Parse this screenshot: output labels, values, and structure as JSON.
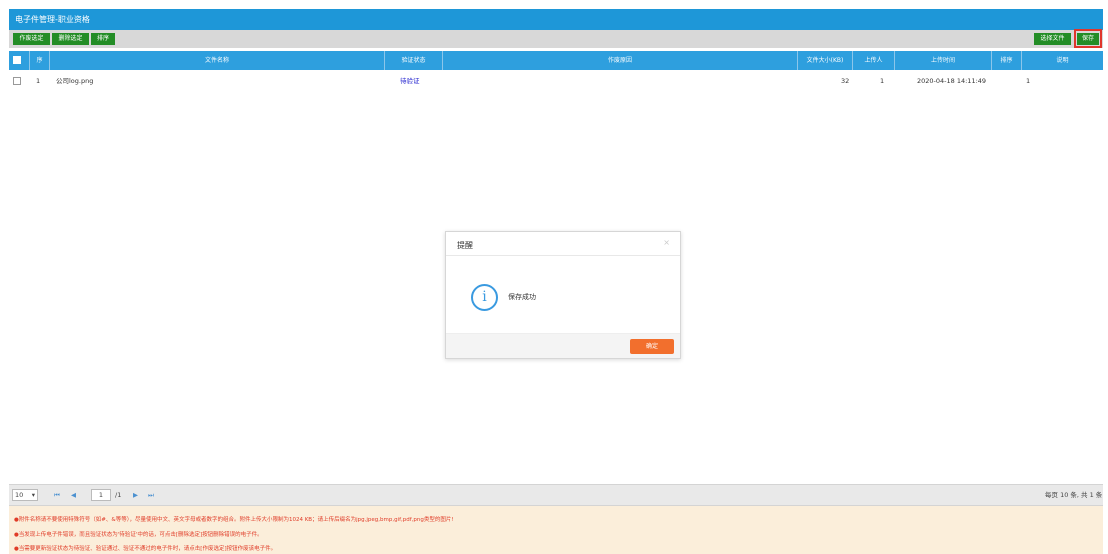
{
  "window": {
    "title": "电子件管理-职业资格"
  },
  "toolbar": {
    "left_buttons": [
      "作废选定",
      "删除选定",
      "排序"
    ],
    "right_buttons": [
      "选择文件",
      "保存"
    ]
  },
  "table": {
    "columns": [
      "序",
      "文件名称",
      "验证状态",
      "作废原因",
      "文件大小(KB)",
      "上传人",
      "上传时间",
      "排序",
      "说明"
    ],
    "rows": [
      {
        "index": "1",
        "file_name": "公司log.png",
        "status": "待验证",
        "reason": "",
        "size": "32",
        "uploader": "1",
        "upload_time": "2020-04-18 14:11:49",
        "order": "1",
        "note": ""
      }
    ]
  },
  "dialog": {
    "title": "提醒",
    "close": "×",
    "icon": "info-icon",
    "message": "保存成功",
    "ok_label": "确定"
  },
  "pager": {
    "page_size": "10",
    "page_size_arrow": "▾",
    "first": "⏮",
    "prev": "◀",
    "current_page": "1",
    "total_pages": "/1",
    "next": "▶",
    "last": "⏭",
    "summary": "每页 10 条, 共 1 条"
  },
  "notes": [
    "●附件名称请不要使用特殊符号（如#、&等等），尽量使用中文、英文字母或者数字的组合。附件上传大小限制为1024 KB；请上传后缀名为jpg,jpeg,bmp,gif,pdf,png类型的图片!",
    "●当发现上传电子件错误，而且验证状态为'待验证'中的话，可点击[删除选定]按钮删除错误的电子件。",
    "●当需要更新验证状态为待验证、验证通过、验证不通过的电子件时，请点击[作废选定]按钮作废该电子件。"
  ],
  "colors": {
    "header_blue": "#1e97d8",
    "button_green": "#238d26",
    "ok_orange": "#f26f2d",
    "note_red": "#e03c28"
  }
}
